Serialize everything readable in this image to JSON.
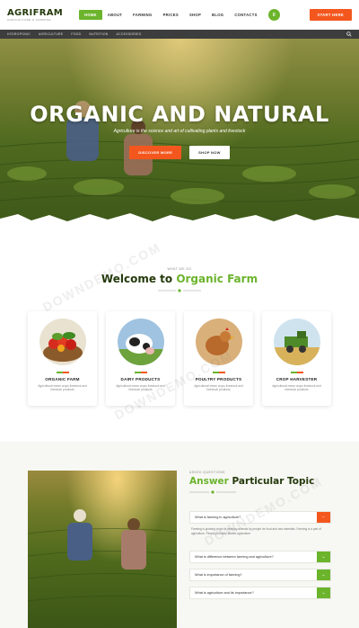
{
  "header": {
    "logo": "AGRIFRAM",
    "logo_tagline": "AGRICULTURE & FARMING",
    "nav": [
      "HOME",
      "ABOUT",
      "FARMING",
      "PRICES",
      "SHOP",
      "BLOG",
      "CONTACTS"
    ],
    "cart_count": "0",
    "start_button": "START HERE"
  },
  "categories": [
    "HYDROPONIC",
    "AGRICULTURE",
    "FOOD",
    "NUTRITION",
    "ACCESSORIES"
  ],
  "hero": {
    "title": "ORGANIC AND NATURAL",
    "subtitle": "Agriculture is the science and art of cultivating plants and livestock",
    "primary_button": "DISCOVER MORE",
    "secondary_button": "SHOP NOW"
  },
  "welcome": {
    "eyebrow": "WHAT WE DO",
    "title_a": "Welcome to ",
    "title_b": "Organic Farm",
    "cards": [
      {
        "title": "ORGANIC FARM",
        "text": "Agricultural mean crops livestock and livestock products"
      },
      {
        "title": "DAIRY PRODUCTS",
        "text": "Agricultural mean crops livestock and livestock products"
      },
      {
        "title": "POULTRY PRODUCTS",
        "text": "Agricultural mean crops livestock and livestock products"
      },
      {
        "title": "CROP HARVESTER",
        "text": "Agricultural mean crops livestock and livestock products"
      }
    ]
  },
  "faq": {
    "eyebrow": "ASKED QUESTIONS",
    "title_a": "Answer ",
    "title_b": "Particular Topic",
    "items": [
      {
        "q": "What is farming in agriculture?",
        "open": true
      },
      {
        "q": "What is difference between farming and agriculture?",
        "open": false
      },
      {
        "q": "What is importance of farming?",
        "open": false
      },
      {
        "q": "What is agriculture and its importance?",
        "open": false
      }
    ],
    "answer": "Farming is growing crops or keeping animals by people for food and raw materials. Farming is a part of agriculture. People probably started agriculture"
  },
  "watermark": "DOWNDEMO.COM",
  "colors": {
    "green": "#6bb42c",
    "orange": "#f4571e",
    "dark": "#243a0c"
  }
}
